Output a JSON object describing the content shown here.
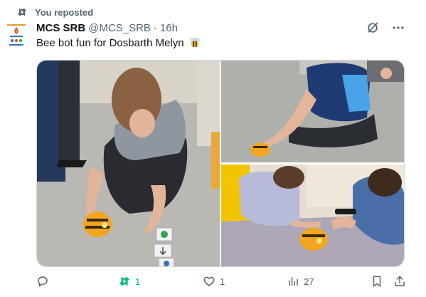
{
  "repost_banner": {
    "text": "You reposted"
  },
  "tweet": {
    "display_name": "MCS SRB",
    "handle": "@MCS_SRB",
    "separator": "·",
    "time": "16h",
    "text": "Bee bot fun for Dosbarth Melyn",
    "emoji": "bee-emoji"
  },
  "header_tools": {
    "grok_icon": "grok-icon",
    "more_icon": "more-horizontal-icon"
  },
  "actions": {
    "reply_count": "",
    "repost_count": "1",
    "like_count": "1",
    "views_count": "27"
  },
  "colors": {
    "repost_active": "#00ba7c",
    "muted": "#536471",
    "text": "#0f1419"
  }
}
